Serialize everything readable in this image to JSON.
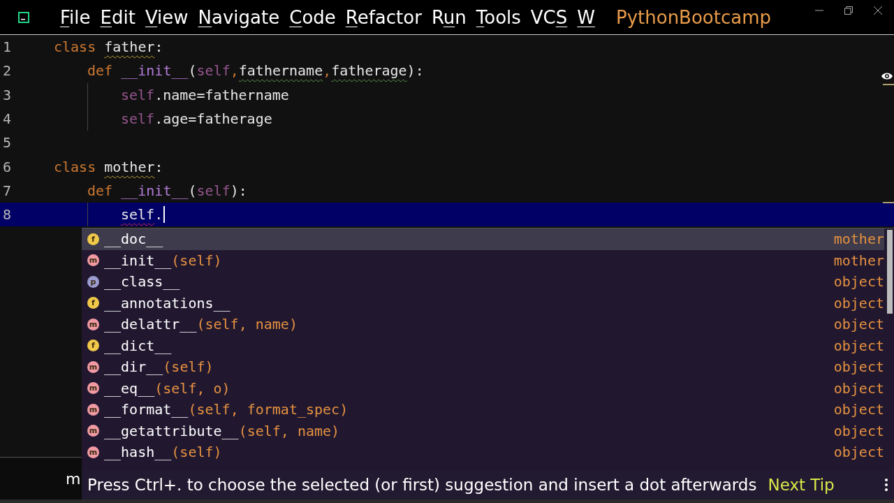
{
  "window": {
    "menu": [
      {
        "key": "F",
        "rest": "ile"
      },
      {
        "key": "E",
        "rest": "dit"
      },
      {
        "key": "V",
        "rest": "iew"
      },
      {
        "key": "N",
        "rest": "avigate"
      },
      {
        "key": "C",
        "rest": "ode"
      },
      {
        "key": "R",
        "rest": "efactor"
      },
      {
        "prefix": "R",
        "key": "u",
        "rest": "n"
      },
      {
        "key": "T",
        "rest": "ools"
      },
      {
        "prefix": "VC",
        "key": "S"
      },
      {
        "key": "W"
      }
    ],
    "project": "PythonBootcamp"
  },
  "editor": {
    "lines": [
      {
        "number": "1",
        "current": false,
        "tokens": [
          {
            "text": "class ",
            "kind": "keyword"
          },
          {
            "text": "father",
            "kind": "warning"
          },
          {
            "text": ":",
            "kind": "plain"
          }
        ],
        "children": [
          {
            "number": "2",
            "current": false,
            "tokens": [
              {
                "text": "def ",
                "kind": "keyword"
              },
              {
                "text": "__init__",
                "kind": "magic"
              },
              {
                "text": "(",
                "kind": "plain"
              },
              {
                "text": "self",
                "kind": "self"
              },
              {
                "text": ",",
                "kind": "keyword"
              },
              {
                "text": "fathername",
                "kind": "typo"
              },
              {
                "text": ",",
                "kind": "keyword"
              },
              {
                "text": "fatherage",
                "kind": "typo"
              },
              {
                "text": "):",
                "kind": "plain"
              }
            ],
            "children": [
              {
                "number": "3",
                "current": false,
                "tokens": [
                  {
                    "text": "self",
                    "kind": "self"
                  },
                  {
                    "text": ".name=fathername",
                    "kind": "plain"
                  }
                ]
              },
              {
                "number": "4",
                "current": false,
                "tokens": [
                  {
                    "text": "self",
                    "kind": "self"
                  },
                  {
                    "text": ".age=fatherage",
                    "kind": "plain"
                  }
                ]
              }
            ]
          }
        ]
      },
      {
        "number": "5",
        "current": false
      },
      {
        "number": "6",
        "current": false,
        "tokens": [
          {
            "text": "class ",
            "kind": "keyword"
          },
          {
            "text": "mother",
            "kind": "warning"
          },
          {
            "text": ":",
            "kind": "plain"
          }
        ],
        "children": [
          {
            "number": "7",
            "current": false,
            "tokens": [
              {
                "text": "def ",
                "kind": "keyword"
              },
              {
                "text": "__init__",
                "kind": "magic"
              },
              {
                "text": "(",
                "kind": "plain"
              },
              {
                "text": "self",
                "kind": "self"
              },
              {
                "text": "):",
                "kind": "plain"
              }
            ],
            "children": [
              {
                "number": "8",
                "current": true,
                "tokens": [
                  {
                    "text": "self",
                    "kind": "error"
                  },
                  {
                    "text": ".",
                    "kind": "plain"
                  }
                ]
              }
            ]
          }
        ]
      }
    ],
    "panel_text": "m"
  },
  "completion": {
    "items": [
      {
        "kind": "field",
        "badge": "f",
        "name": "__doc__",
        "type": "mother",
        "selected": true
      },
      {
        "kind": "method",
        "badge": "m",
        "name": "__init__",
        "params": "(self)",
        "type": "mother",
        "selected": false
      },
      {
        "kind": "property",
        "badge": "p",
        "name": "__class__",
        "type": "object",
        "selected": false
      },
      {
        "kind": "field",
        "badge": "f",
        "name": "__annotations__",
        "type": "object",
        "selected": false
      },
      {
        "kind": "method",
        "badge": "m",
        "name": "__delattr__",
        "params": "(self, name)",
        "type": "object",
        "selected": false
      },
      {
        "kind": "field",
        "badge": "f",
        "name": "__dict__",
        "type": "object",
        "selected": false
      },
      {
        "kind": "method",
        "badge": "m",
        "name": "__dir__",
        "params": "(self)",
        "type": "object",
        "selected": false
      },
      {
        "kind": "method",
        "badge": "m",
        "name": "__eq__",
        "params": "(self, o)",
        "type": "object",
        "selected": false
      },
      {
        "kind": "method",
        "badge": "m",
        "name": "__format__",
        "params": "(self, format_spec)",
        "type": "object",
        "selected": false
      },
      {
        "kind": "method",
        "badge": "m",
        "name": "__getattribute__",
        "params": "(self, name)",
        "type": "object",
        "selected": false
      },
      {
        "kind": "method",
        "badge": "m",
        "name": "__hash__",
        "params": "(self)",
        "type": "object",
        "selected": false
      }
    ],
    "tip": "Press Ctrl+. to choose the selected (or first) suggestion and insert a dot afterwards",
    "next_tip": "Next Tip"
  }
}
